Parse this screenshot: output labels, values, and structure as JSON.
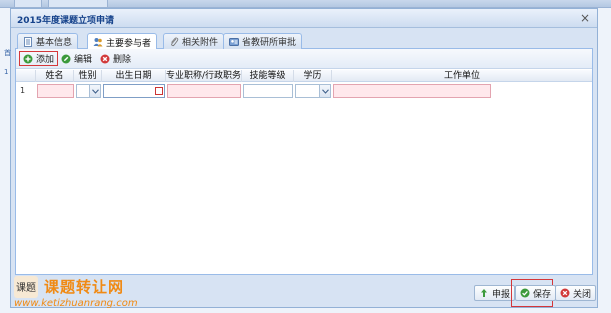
{
  "dialog": {
    "title": "2015年度课题立项申请"
  },
  "tabs": [
    {
      "label": "基本信息",
      "icon": "document-icon",
      "active": false
    },
    {
      "label": "主要参与者",
      "icon": "users-icon",
      "active": true
    },
    {
      "label": "相关附件",
      "icon": "paperclip-icon",
      "active": false
    },
    {
      "label": "省教研所审批",
      "icon": "user-card-icon",
      "active": false
    }
  ],
  "toolbar": {
    "add_label": "添加",
    "edit_label": "编辑",
    "delete_label": "删除"
  },
  "grid": {
    "columns": [
      "姓名",
      "性别",
      "出生日期",
      "专业职称/行政职务",
      "技能等级",
      "学历",
      "工作单位"
    ],
    "rows": [
      {
        "row_number": "1"
      }
    ]
  },
  "footer": {
    "submit_label": "申报",
    "save_label": "保存",
    "close_label": "关闭"
  },
  "watermark": {
    "logo_text": "课题",
    "name": "课题转让网",
    "url": "www.ketizhuanrang.com"
  },
  "colors": {
    "accent_red": "#d4373a",
    "invalid_cell": "#ffe8ec",
    "watermark_orange": "#f08a14",
    "title_blue": "#15428b"
  }
}
